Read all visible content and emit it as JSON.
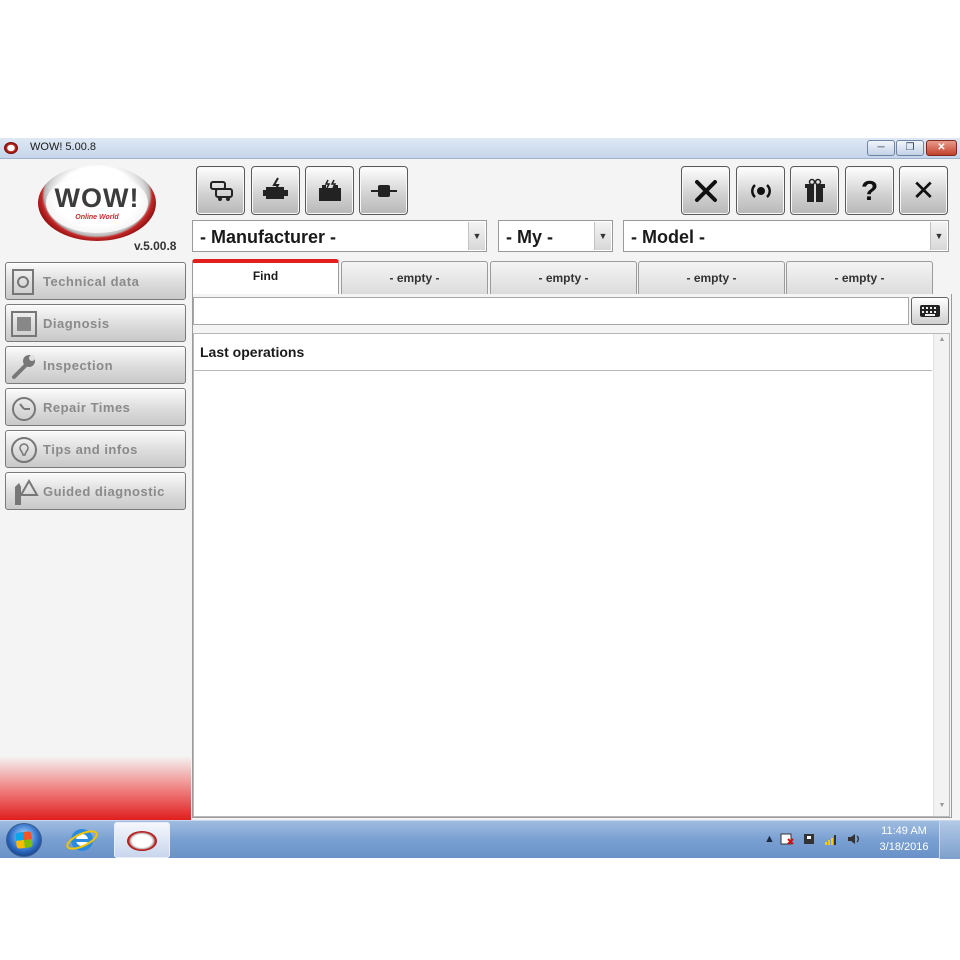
{
  "window": {
    "title": "WOW! 5.00.8",
    "minimize_label": "─",
    "maximize_label": "❐",
    "close_label": "✕"
  },
  "logo": {
    "text": "WOW!",
    "subtext": "Online World",
    "version": "v.5.00.8"
  },
  "toolbar": {
    "left_buttons": [
      "vehicle-selection-icon",
      "engine-icon",
      "battery-icon",
      "connector-icon"
    ],
    "right_buttons": [
      "tools-icon",
      "bluetooth-icon",
      "gift-icon",
      "help-icon",
      "exit-icon"
    ],
    "help_glyph": "?",
    "exit_glyph": "✕"
  },
  "selectors": {
    "manufacturer": "- Manufacturer -",
    "my": "- My -",
    "model": "- Model -",
    "arrow": "▼"
  },
  "sidebar": {
    "items": [
      {
        "label": "Technical data",
        "icon": "technical-data-icon"
      },
      {
        "label": "Diagnosis",
        "icon": "diagnosis-icon"
      },
      {
        "label": "Inspection",
        "icon": "wrench-icon"
      },
      {
        "label": "Repair Times",
        "icon": "stopwatch-icon"
      },
      {
        "label": "Tips and infos",
        "icon": "lightbulb-icon"
      },
      {
        "label": "Guided diagnostic",
        "icon": "guided-diagnostic-icon"
      }
    ]
  },
  "tabs": [
    {
      "label": "Find",
      "active": true
    },
    {
      "label": "-  empty  -",
      "active": false
    },
    {
      "label": "-  empty  -",
      "active": false
    },
    {
      "label": "-  empty  -",
      "active": false
    },
    {
      "label": "-  empty  -",
      "active": false
    }
  ],
  "search": {
    "value": "",
    "keyboard_icon": "keyboard-icon"
  },
  "list": {
    "header": "Last operations",
    "scroll_up": "▲",
    "scroll_down": "▼"
  },
  "taskbar": {
    "tray_arrow": "▲",
    "time": "11:49 AM",
    "date": "3/18/2016"
  },
  "colors": {
    "accent_red": "#e31e1e",
    "taskbar_blue": "#7aa0d2"
  }
}
